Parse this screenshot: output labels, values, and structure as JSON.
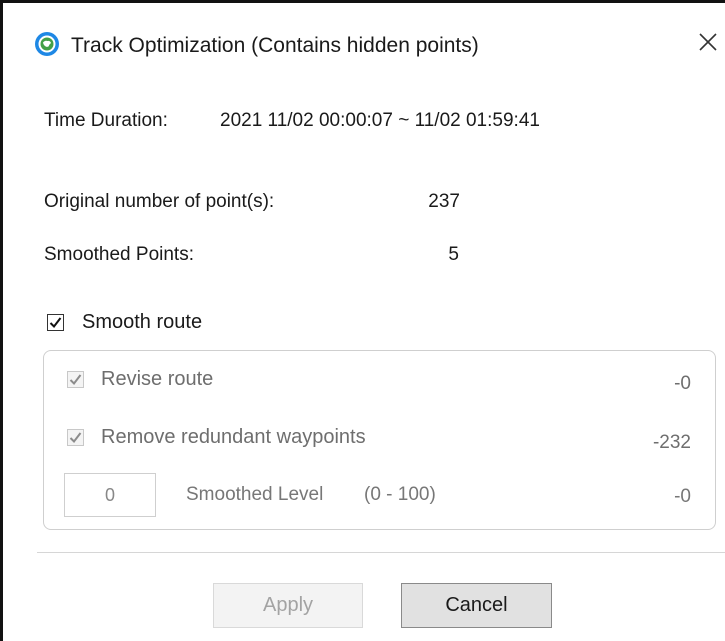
{
  "window": {
    "title": "Track Optimization (Contains hidden points)",
    "icon": "app-globe-icon",
    "close_icon": "close-icon"
  },
  "info": {
    "time_duration_label": "Time Duration:",
    "time_duration_value": "2021 11/02 00:00:07 ~ 11/02 01:59:41",
    "original_points_label": "Original number of point(s):",
    "original_points_value": "237",
    "smoothed_points_label": "Smoothed Points:",
    "smoothed_points_value": "5"
  },
  "smooth_route": {
    "label": "Smooth route",
    "checked": true
  },
  "options": {
    "revise_route": {
      "label": "Revise route",
      "checked": true,
      "enabled": false,
      "delta": "-0"
    },
    "remove_redundant": {
      "label": "Remove redundant waypoints",
      "checked": true,
      "enabled": false,
      "delta": "-232"
    },
    "smoothed_level": {
      "value": "0",
      "label": "Smoothed Level",
      "range": "(0 - 100)",
      "delta": "-0"
    }
  },
  "buttons": {
    "apply_label": "Apply",
    "apply_enabled": false,
    "cancel_label": "Cancel"
  },
  "colors": {
    "icon_blue": "#1e88e5",
    "icon_green": "#43a047",
    "disabled_text": "#a3a3a3",
    "group_border": "#cfcfcf"
  }
}
